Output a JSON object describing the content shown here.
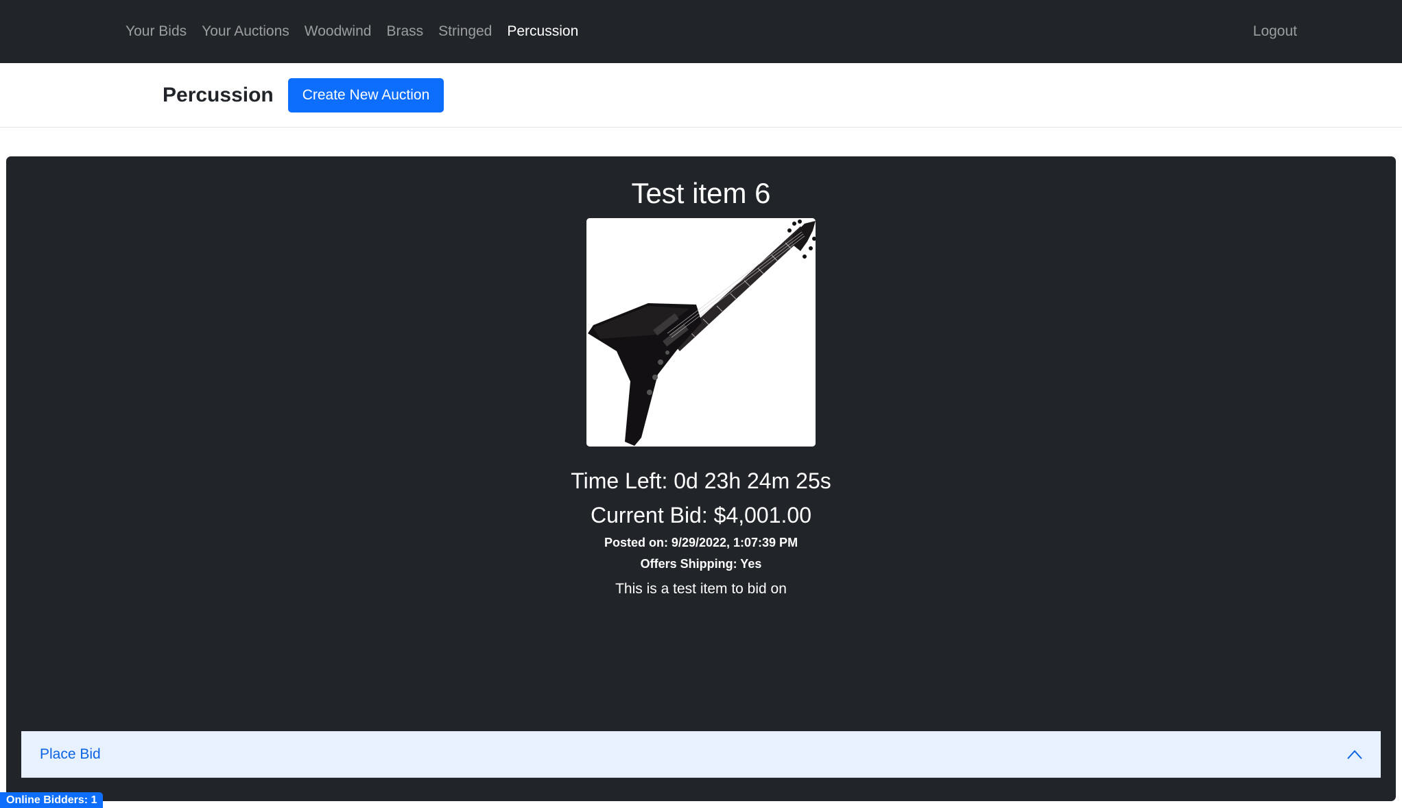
{
  "navbar": {
    "links": [
      {
        "label": "Your Bids"
      },
      {
        "label": "Your Auctions"
      },
      {
        "label": "Woodwind"
      },
      {
        "label": "Brass"
      },
      {
        "label": "Stringed"
      },
      {
        "label": "Percussion"
      }
    ],
    "active": "Percussion",
    "logout_label": "Logout"
  },
  "subheader": {
    "title": "Percussion",
    "create_button_label": "Create New Auction"
  },
  "auction": {
    "title": "Test item 6",
    "image_icon": "electric-guitar-icon",
    "time_left": "Time Left: 0d 23h 24m 25s",
    "current_bid": "Current Bid: $4,001.00",
    "posted_on": "Posted on: 9/29/2022, 1:07:39 PM",
    "offers_shipping": "Offers Shipping: Yes",
    "description": "This is a test item to bid on",
    "place_bid_label": "Place Bid",
    "accordion_icon": "chevron-up-icon"
  },
  "status": {
    "online_bidders": "Online Bidders: 1"
  },
  "colors": {
    "navbar_bg": "#212529",
    "card_bg": "#212529",
    "primary": "#0d6efd",
    "accordion_bg": "#e7f1ff",
    "accordion_text": "#0c63e4"
  }
}
